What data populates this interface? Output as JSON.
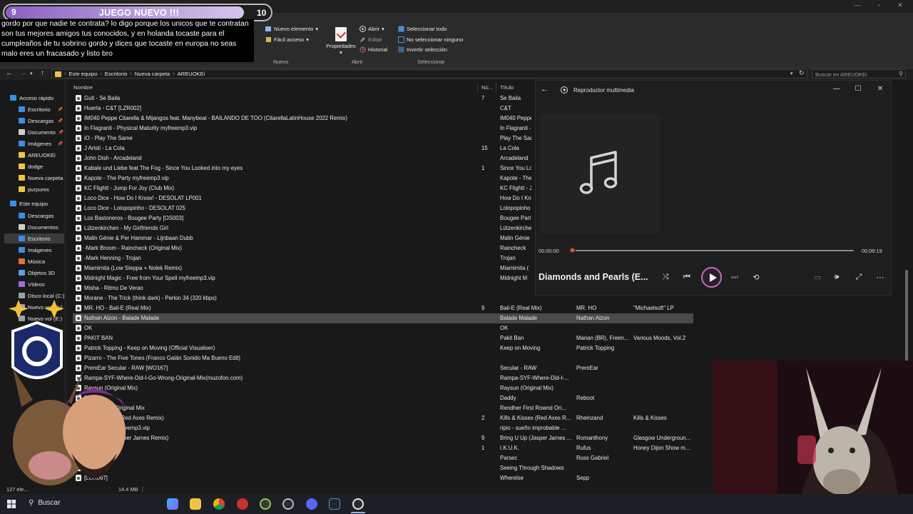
{
  "overlay": {
    "banner_left": "9",
    "banner_text": "JUEGO NUEVO !!!",
    "banner_right": "10",
    "chat_text": "gordo por que nadie te contrata? lo digo porque los unicos que te contratan son tus mejores amigos tus conocidos, y en holanda tocaste para el cumpleaños de tu sobrino gordo y dices que tocaste en europa no seas malo eres un fracasado y listo bro"
  },
  "ribbon": {
    "nuevo_elemento": "Nuevo elemento",
    "facil_acceso": "Fácil acceso",
    "propiedades": "Propiedades",
    "abrir": "Abrir",
    "editar": "Editar",
    "historial": "Historial",
    "seleccionar_todo": "Seleccionar todo",
    "no_seleccionar": "No seleccionar ninguno",
    "invertir": "Invertir selección",
    "group_nuevo": "Nuevo",
    "group_abrir": "Abrir",
    "group_seleccionar": "Seleccionar"
  },
  "address": {
    "crumbs": [
      "Este equipo",
      "Escritorio",
      "Nueva carpeta",
      "AREUOKEi"
    ],
    "search_placeholder": "Buscar en AREUOKEi"
  },
  "sidebar": {
    "items": [
      {
        "label": "Acceso rápido",
        "icon": "star-icon",
        "color": "#3b8ee0",
        "pin": false
      },
      {
        "label": "Escritorio",
        "icon": "desktop-icon",
        "color": "#3b8ee0",
        "pin": true
      },
      {
        "label": "Descargas",
        "icon": "download-icon",
        "color": "#3b8ee0",
        "pin": true
      },
      {
        "label": "Documento",
        "icon": "document-icon",
        "color": "#cfcfcf",
        "pin": true
      },
      {
        "label": "Imágenes",
        "icon": "images-icon",
        "color": "#3b8ee0",
        "pin": true
      },
      {
        "label": "AREUOKEi",
        "icon": "folder-icon",
        "color": "#f0c443",
        "pin": false
      },
      {
        "label": "dodge",
        "icon": "folder-icon",
        "color": "#f0c443",
        "pin": false
      },
      {
        "label": "Nueva carpeta",
        "icon": "folder-icon",
        "color": "#f0c443",
        "pin": false
      },
      {
        "label": "purpurex",
        "icon": "folder-icon",
        "color": "#f0c443",
        "pin": false
      },
      {
        "label": "Este equipo",
        "icon": "pc-icon",
        "color": "#3b8ee0",
        "pin": false
      },
      {
        "label": "Descargas",
        "icon": "download-icon",
        "color": "#3b8ee0",
        "pin": false
      },
      {
        "label": "Documentos",
        "icon": "document-icon",
        "color": "#cfcfcf",
        "pin": false
      },
      {
        "label": "Escritorio",
        "icon": "desktop-icon",
        "color": "#3b8ee0",
        "pin": false
      },
      {
        "label": "Imágenes",
        "icon": "images-icon",
        "color": "#3b8ee0",
        "pin": false
      },
      {
        "label": "Música",
        "icon": "music-icon",
        "color": "#e0703b",
        "pin": false
      },
      {
        "label": "Objetos 3D",
        "icon": "cube-icon",
        "color": "#5aa0e0",
        "pin": false
      },
      {
        "label": "Vídeos",
        "icon": "video-icon",
        "color": "#9a6de0",
        "pin": false
      },
      {
        "label": "Disco local (C:)",
        "icon": "drive-icon",
        "color": "#9aa3ad",
        "pin": false
      },
      {
        "label": "Nuevo vol (D:)",
        "icon": "drive-icon",
        "color": "#9aa3ad",
        "pin": false
      },
      {
        "label": "Nuevo vol (E:)",
        "icon": "drive-icon",
        "color": "#9aa3ad",
        "pin": false
      }
    ]
  },
  "columns": {
    "name": "Nombre",
    "num": "Nú...",
    "title": "Título"
  },
  "files": [
    {
      "name": "Guti - Se Baila",
      "num": "7",
      "title": "Se Baila",
      "artist": "",
      "album": ""
    },
    {
      "name": "Huerta - C&T [LZR002]",
      "num": "",
      "title": "C&T",
      "artist": "",
      "album": ""
    },
    {
      "name": "IM040 Peppe Citarella & Mijangos feat. Manybeat - BAILANDO DE TOO (CitarellaLatinHouse 2022 Remix)",
      "num": "",
      "title": "IM040 Peppe",
      "artist": "",
      "album": ""
    },
    {
      "name": "In Flagranti - Physical Maturity myfreemp3.vip",
      "num": "",
      "title": "In Flagranti -",
      "artist": "",
      "album": ""
    },
    {
      "name": "iO - Play The Same",
      "num": "",
      "title": "Play The Sam",
      "artist": "",
      "album": ""
    },
    {
      "name": "J Aristi - La Cola",
      "num": "15",
      "title": "La Cola",
      "artist": "",
      "album": ""
    },
    {
      "name": "John Dish - Arcadeland",
      "num": "",
      "title": "Arcadeland",
      "artist": "",
      "album": ""
    },
    {
      "name": "Kabale und Liebe feat The Fog - Since You Looked into my eyes",
      "num": "1",
      "title": "Since You Lo",
      "artist": "",
      "album": ""
    },
    {
      "name": "Kapote - The Party myfreemp3.vip",
      "num": "",
      "title": "Kapote - The",
      "artist": "",
      "album": ""
    },
    {
      "name": "KC Flightt - Jump For Joy (Club Mix)",
      "num": "",
      "title": "KC Flightt - J",
      "artist": "",
      "album": ""
    },
    {
      "name": "Loco Dice - How Do I Know! - DESOLAT LP001",
      "num": "",
      "title": "How Do I Kn",
      "artist": "",
      "album": ""
    },
    {
      "name": "Loco Dice - Lolopopinho - DESOLAT 025",
      "num": "",
      "title": "Lolopopinho",
      "artist": "",
      "album": ""
    },
    {
      "name": "Los Bastoneros - Bougee Party [OS003]",
      "num": "",
      "title": "Bougee Part",
      "artist": "",
      "album": ""
    },
    {
      "name": "Lützenkirchen - My Girlfriends Girl",
      "num": "",
      "title": "Lützenkirche",
      "artist": "",
      "album": ""
    },
    {
      "name": "Malin Génie & Per Hammar - Lijnbaan Dubb",
      "num": "",
      "title": "Malin Génie",
      "artist": "",
      "album": ""
    },
    {
      "name": "-Mark Broom - Raincheck (Original Mix)",
      "num": "",
      "title": "Raincheck",
      "artist": "",
      "album": ""
    },
    {
      "name": "-Mark Henning - Trojan",
      "num": "",
      "title": "Trojan",
      "artist": "",
      "album": ""
    },
    {
      "name": "Miamimita (Low Steppa + Nolek Remix)",
      "num": "",
      "title": "Miamimita (",
      "artist": "",
      "album": ""
    },
    {
      "name": "Midnight Magic - Free from Your Spell myfreemp3.vip",
      "num": "",
      "title": "Midnight M",
      "artist": "",
      "album": ""
    },
    {
      "name": "Misha - Ritmo De Verao",
      "num": "",
      "title": "",
      "artist": "",
      "album": ""
    },
    {
      "name": "Morane - The Trick (think dark) - Perlon 34 (320 kbps)",
      "num": "",
      "title": "",
      "artist": "",
      "album": ""
    },
    {
      "name": "MR. HO - Bail-E (Real Mix)",
      "num": "9",
      "title": "Bail-E (Real Mix)",
      "artist": "MR. HO",
      "album": "\"Michaelsoft\" LP"
    },
    {
      "name": "Nathan Alzon - Balade Malade",
      "num": "",
      "title": "Balade Malade",
      "artist": "Nathan Alzon",
      "album": ""
    },
    {
      "name": "OK",
      "num": "",
      "title": "OK",
      "artist": "",
      "album": ""
    },
    {
      "name": "PAKIT BAN",
      "num": "",
      "title": "Pakit Ban",
      "artist": "Marian (BR), Freen...",
      "album": "Various Moods, Vol.2"
    },
    {
      "name": "Patrick Topping - Keep on Moving (Official Visualiser)",
      "num": "",
      "title": "Keep on Moving",
      "artist": "Patrick Topping",
      "album": ""
    },
    {
      "name": "Pizarro - The Five Tones (Franco Galán Sonido Ma Bueno Edit)",
      "num": "",
      "title": "",
      "artist": "",
      "album": ""
    },
    {
      "name": "PremEar Secular - RAW [WO167]",
      "num": "",
      "title": "Secular - RAW",
      "artist": "PremEar",
      "album": ""
    },
    {
      "name": "Rampa-SYF-Where-Did-I-Go-Wrong-Original-Mix(muzofon.com)",
      "num": "",
      "title": "Rampa-SYF-Where-Did-I-...",
      "artist": "",
      "album": ""
    },
    {
      "name": "Raysun (Original Mix)",
      "num": "",
      "title": "Raysun (Original Mix)",
      "artist": "",
      "album": ""
    },
    {
      "name": "Daddy",
      "num": "",
      "title": "Daddy",
      "artist": "Reboot",
      "album": ""
    },
    {
      "name": "First Rownd Original Mix",
      "num": "",
      "title": "Rendher First Rownd Ori...",
      "artist": "",
      "album": ""
    },
    {
      "name": "Kills & Kisses (Red Axes Remix)",
      "num": "2",
      "title": "Kills & Kisses (Red Axes R...",
      "artist": "Rheinzand",
      "album": "Kills & Kisses"
    },
    {
      "name": "improbable myfreemp3.vip",
      "num": "",
      "title": "ripio - sueño improbable ...",
      "artist": "",
      "album": ""
    },
    {
      "name": "Bring U Up (Jasper James Remix)",
      "num": "9",
      "title": "Bring U Up (Jasper James ...",
      "artist": "Romanthony",
      "album": "Glasgow Undergroun..."
    },
    {
      "name": "",
      "num": "1",
      "title": "I.K.U.K.",
      "artist": "Rufus",
      "album": "Honey Dijon Show m..."
    },
    {
      "name": "Parsec",
      "num": "",
      "title": "Parsec",
      "artist": "Russ Gabriel",
      "album": ""
    },
    {
      "name": "Shadows",
      "num": "",
      "title": "Seeing Through Shadows",
      "artist": "",
      "album": ""
    },
    {
      "name": "[LOK067]",
      "num": "",
      "title": "Wherelse",
      "artist": "Sepp",
      "album": ""
    }
  ],
  "status": {
    "items": "127 ele...",
    "size": "14.4 MB"
  },
  "player": {
    "app_title": "Reproductor multimedia",
    "song_title": "Diamonds and Pearls (E...",
    "time_elapsed": "00:00:00",
    "time_total": "00:06:19",
    "progress": 0.0
  },
  "taskbar": {
    "search_label": "Buscar"
  },
  "colors": {
    "accent": "#c86bb8",
    "progress_knob": "#e8603c",
    "banner_purple": "#8b5fc0"
  }
}
